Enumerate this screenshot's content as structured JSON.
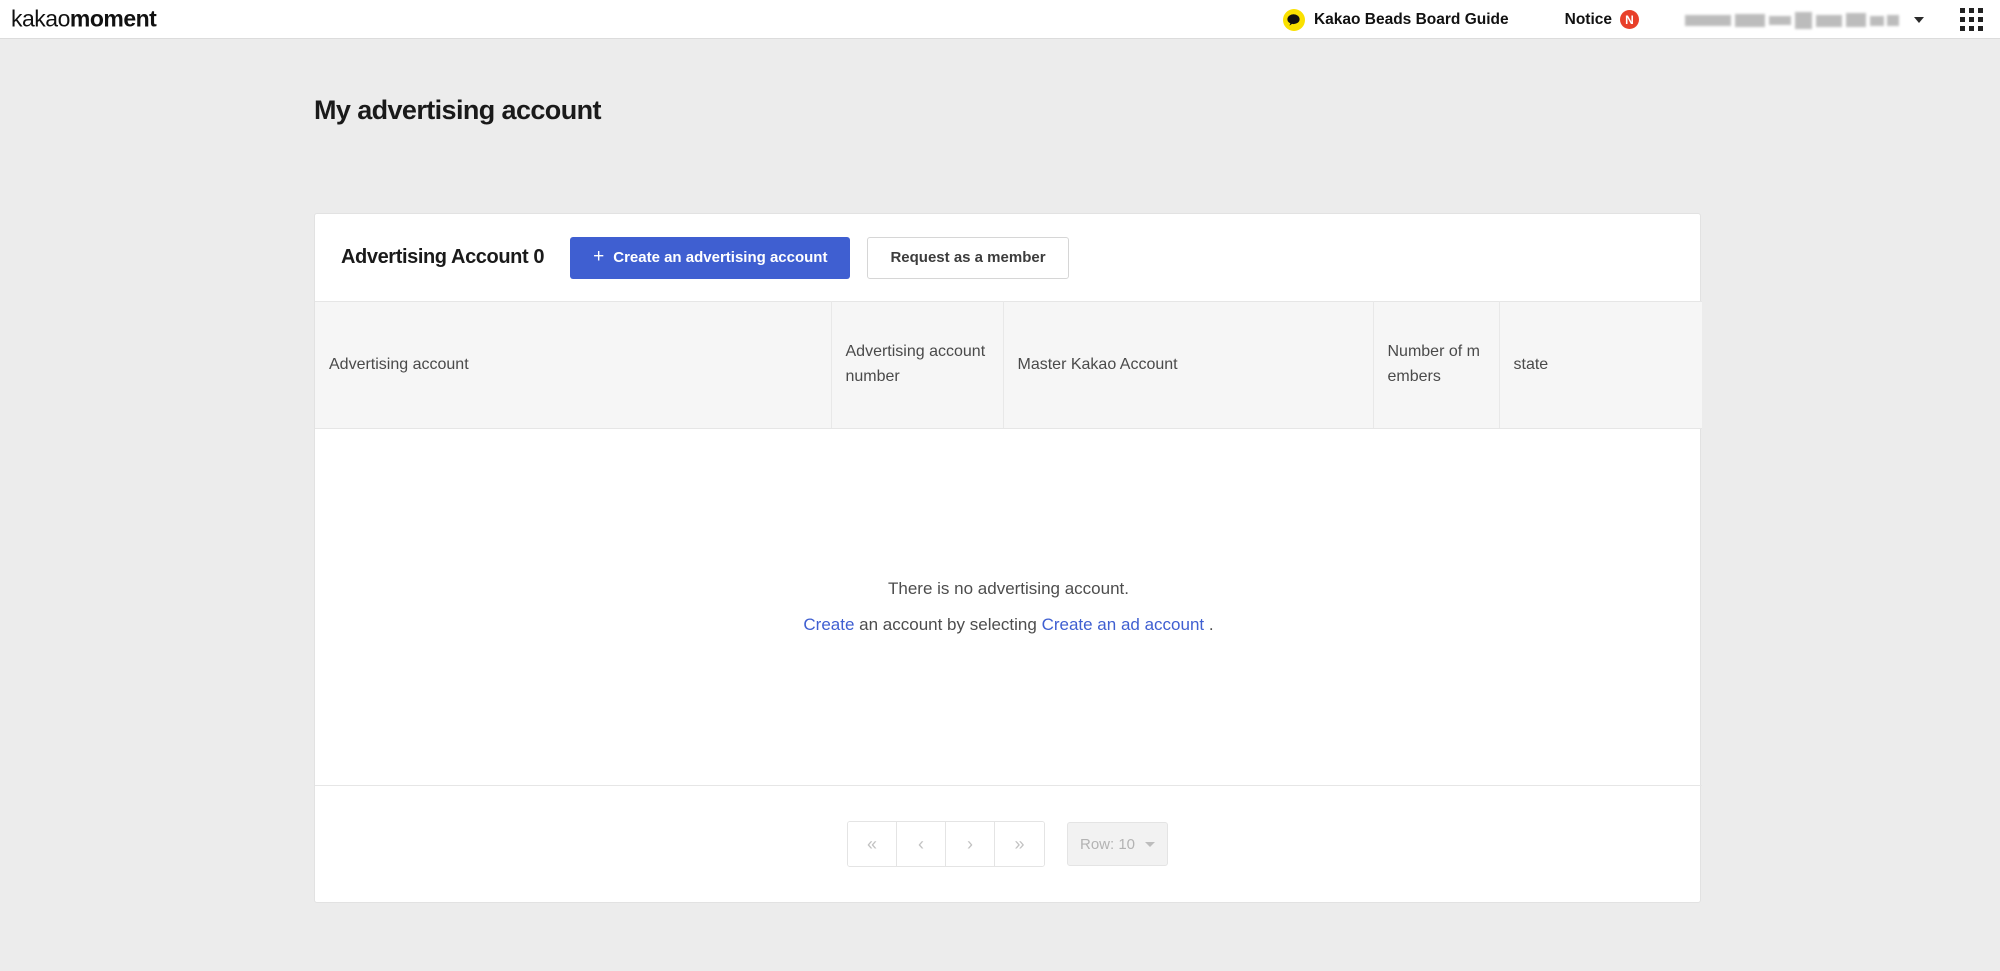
{
  "topbar": {
    "brand_light": "kakao",
    "brand_bold": "moment",
    "guide_label": "Kakao Beads Board Guide",
    "guide_icon": "kakao-speech-bubble-icon",
    "notice_label": "Notice",
    "notice_badge": "N",
    "account_name_masked": "",
    "apps_icon": "apps-grid-icon"
  },
  "page": {
    "title": "My advertising account"
  },
  "card": {
    "heading": "Advertising Account 0",
    "create_button": "Create an advertising account",
    "create_button_icon": "+",
    "member_button": "Request as a member"
  },
  "table": {
    "columns": [
      "Advertising account",
      "Advertising account number",
      "Master Kakao Account",
      "Number of members",
      "state"
    ],
    "rows": [],
    "empty": {
      "line1": "There is no advertising account.",
      "line2_link1": "Create",
      "line2_mid": " an account by selecting ",
      "line2_link2": "Create an ad account",
      "line2_end": " ."
    }
  },
  "pagination": {
    "first": "«",
    "prev": "‹",
    "next": "›",
    "last": "»",
    "rows_per_page": "Row: 10"
  },
  "colors": {
    "primary": "#3f5fd1",
    "link": "#3f5fd1",
    "kakao_yellow": "#fae100",
    "notice_red": "#e8402a",
    "page_bg": "#ececec",
    "header_row_bg": "#f6f6f6"
  }
}
